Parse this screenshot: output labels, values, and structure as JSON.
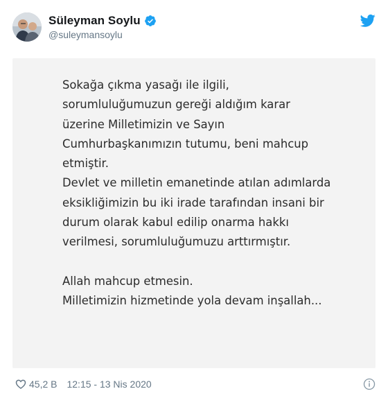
{
  "author": {
    "display_name": "Süleyman Soylu",
    "handle": "@suleymansoylu",
    "verified": true,
    "avatar_icon": "profile-photo"
  },
  "brand": {
    "icon": "twitter-bird-icon",
    "color": "#1da1f2"
  },
  "image_text": {
    "lines": [
      "Sokağa çıkma yasağı ile ilgili,",
      "sorumluluğumuzun gereği aldığım karar",
      "üzerine Milletimizin ve Sayın",
      "Cumhurbaşkanımızın tutumu, beni mahcup",
      "etmiştir.",
      "Devlet ve milletin emanetinde atılan adımlarda",
      "eksikliğimizin bu iki irade tarafından insani bir",
      "durum olarak kabul edilip onarma hakkı",
      "verilmesi, sorumluluğumuzu arttırmıştır.",
      "",
      "Allah mahcup etmesin.",
      "Milletimizin hizmetinde yola devam inşallah..."
    ]
  },
  "footer": {
    "like_icon": "heart-icon",
    "like_count": "45,2 B",
    "timestamp": "12:15 - 13 Nis 2020",
    "info_icon": "info-icon"
  }
}
